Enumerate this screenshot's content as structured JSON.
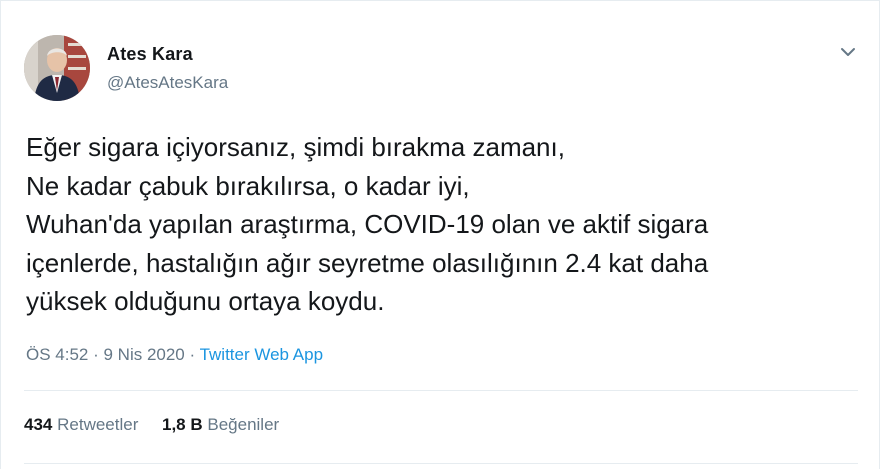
{
  "user": {
    "display_name": "Ates Kara",
    "handle": "@AtesAtesKara"
  },
  "tweet": {
    "lines": [
      "Eğer sigara içiyorsanız, şimdi bırakma zamanı,",
      "Ne kadar çabuk bırakılırsa, o kadar iyi,",
      "Wuhan'da yapılan araştırma, COVID-19 olan ve aktif sigara",
      "içenlerde, hastalığın ağır seyretme olasılığının 2.4 kat daha",
      "yüksek olduğunu ortaya koydu."
    ],
    "time": "ÖS 4:52",
    "sep1": " · ",
    "date": "9 Nis 2020",
    "sep2": " · ",
    "source": "Twitter Web App"
  },
  "stats": {
    "retweets_count": "434",
    "retweets_label": "Retweetler",
    "likes_count": "1,8 B",
    "likes_label": "Beğeniler"
  },
  "icons": {
    "menu": "chevron-down-icon"
  },
  "colors": {
    "text": "#14171a",
    "secondary": "#657786",
    "link": "#1b95e0",
    "border": "#e6ecf0"
  }
}
